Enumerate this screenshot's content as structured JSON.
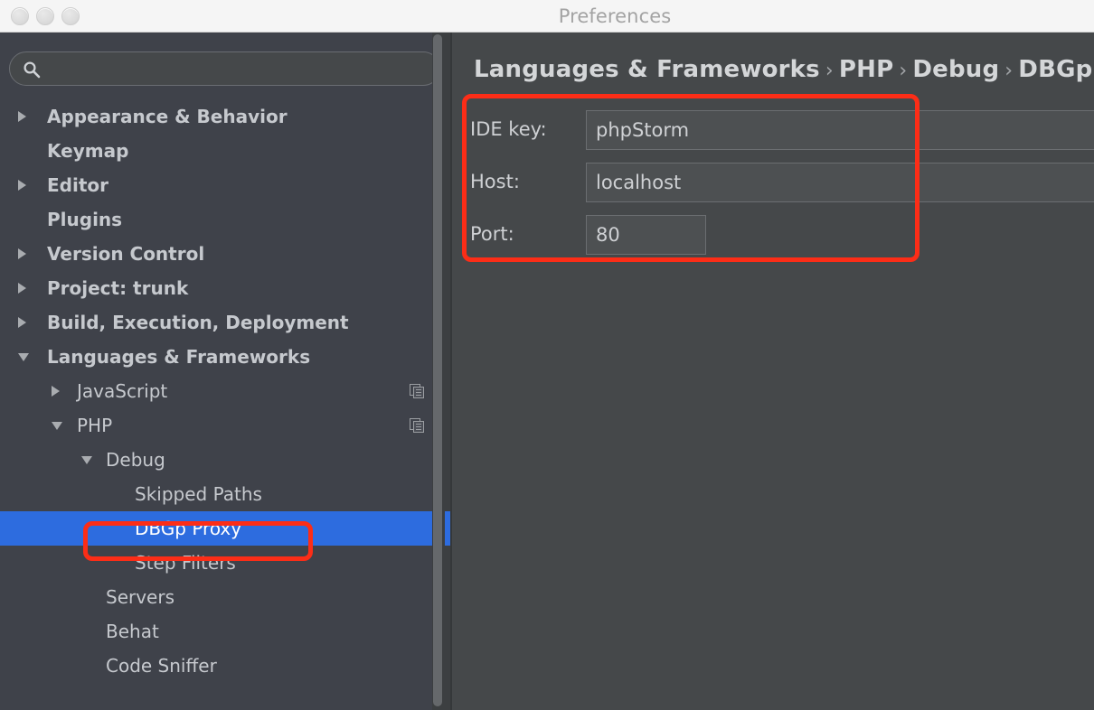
{
  "window": {
    "title": "Preferences",
    "traffic_lights": [
      "close-button",
      "minimize-button",
      "zoom-button"
    ]
  },
  "sidebar": {
    "search": {
      "value": "",
      "placeholder": "",
      "icon": "search-icon"
    },
    "items": [
      {
        "label": "Appearance & Behavior",
        "level": 1,
        "arrow": "right",
        "bold": true,
        "selected": false,
        "icon": null
      },
      {
        "label": "Keymap",
        "level": 1,
        "arrow": null,
        "bold": true,
        "selected": false,
        "icon": null
      },
      {
        "label": "Editor",
        "level": 1,
        "arrow": "right",
        "bold": true,
        "selected": false,
        "icon": null
      },
      {
        "label": "Plugins",
        "level": 1,
        "arrow": null,
        "bold": true,
        "selected": false,
        "icon": null
      },
      {
        "label": "Version Control",
        "level": 1,
        "arrow": "right",
        "bold": true,
        "selected": false,
        "icon": null
      },
      {
        "label": "Project: trunk",
        "level": 1,
        "arrow": "right",
        "bold": true,
        "selected": false,
        "icon": null
      },
      {
        "label": "Build, Execution, Deployment",
        "level": 1,
        "arrow": "right",
        "bold": true,
        "selected": false,
        "icon": null
      },
      {
        "label": "Languages & Frameworks",
        "level": 1,
        "arrow": "down",
        "bold": true,
        "selected": false,
        "icon": null
      },
      {
        "label": "JavaScript",
        "level": 2,
        "arrow": "right",
        "bold": false,
        "selected": false,
        "icon": "copy-scope-icon"
      },
      {
        "label": "PHP",
        "level": 2,
        "arrow": "down",
        "bold": false,
        "selected": false,
        "icon": "copy-scope-icon"
      },
      {
        "label": "Debug",
        "level": 3,
        "arrow": "down",
        "bold": false,
        "selected": false,
        "icon": null
      },
      {
        "label": "Skipped Paths",
        "level": 4,
        "arrow": null,
        "bold": false,
        "selected": false,
        "icon": null
      },
      {
        "label": "DBGp Proxy",
        "level": 4,
        "arrow": null,
        "bold": false,
        "selected": true,
        "icon": null
      },
      {
        "label": "Step Filters",
        "level": 4,
        "arrow": null,
        "bold": false,
        "selected": false,
        "icon": null
      },
      {
        "label": "Servers",
        "level": 3,
        "arrow": null,
        "bold": false,
        "selected": false,
        "icon": null
      },
      {
        "label": "Behat",
        "level": 3,
        "arrow": null,
        "bold": false,
        "selected": false,
        "icon": null
      },
      {
        "label": "Code Sniffer",
        "level": 3,
        "arrow": null,
        "bold": false,
        "selected": false,
        "icon": null
      }
    ]
  },
  "main": {
    "breadcrumb": {
      "parts": [
        "Languages & Frameworks",
        "PHP",
        "Debug",
        "DBGp Pr"
      ],
      "separator": "›"
    },
    "fields": [
      {
        "label": "IDE key:",
        "value": "phpStorm",
        "size": "wide"
      },
      {
        "label": "Host:",
        "value": "localhost",
        "size": "wide"
      },
      {
        "label": "Port:",
        "value": "80",
        "size": "small"
      }
    ]
  },
  "annotations": [
    {
      "name": "dbgp-proxy-settings-highlight",
      "color": "#fc2d17"
    },
    {
      "name": "dbgp-proxy-tree-item-highlight",
      "color": "#fc2d17"
    }
  ],
  "colors": {
    "accent_selection": "#2d6cdf",
    "annotation": "#fc2d17",
    "sidebar_bg": "#3f424a",
    "panel_bg": "#45484a",
    "titlebar_bg": "#f5f5f5"
  }
}
